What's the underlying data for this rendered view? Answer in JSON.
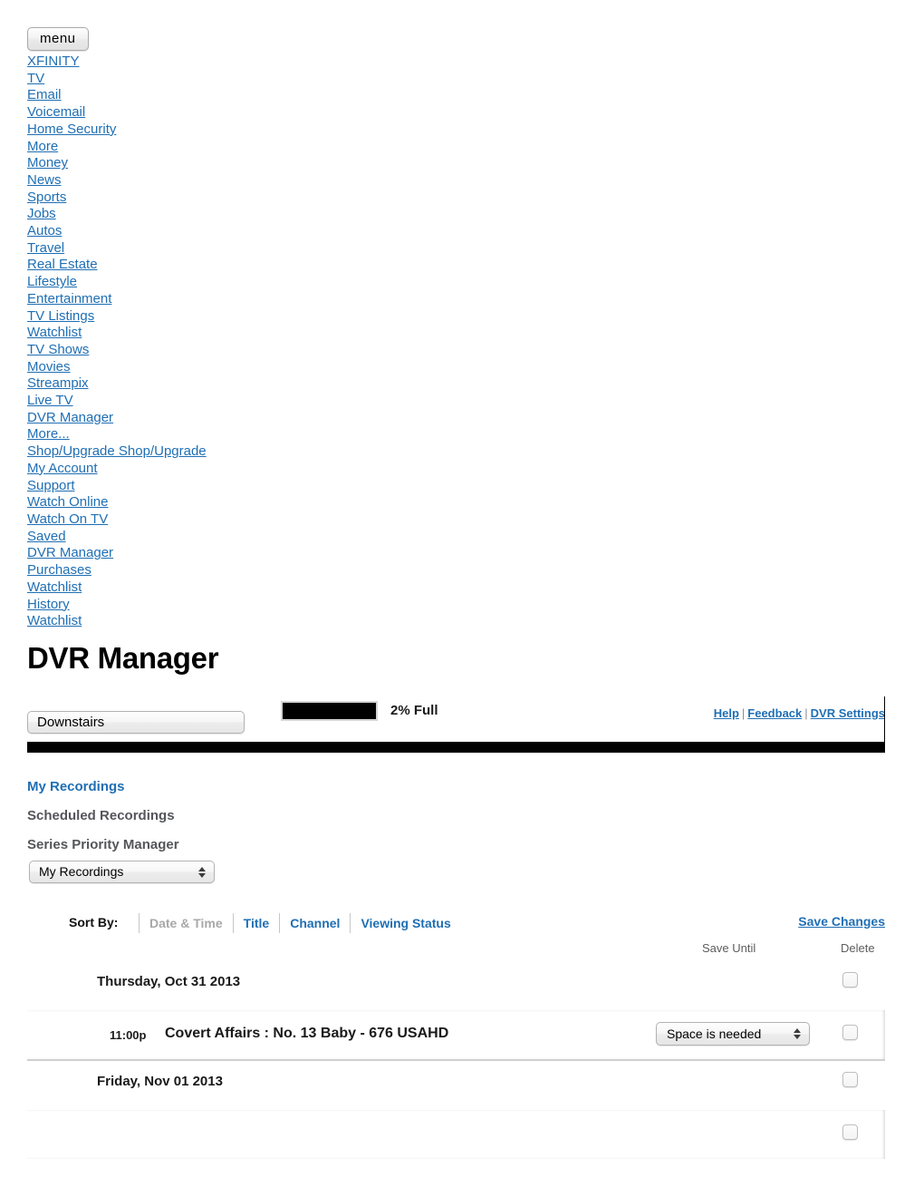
{
  "nav": {
    "menu_button": "menu",
    "links": [
      "XFINITY",
      "TV",
      "Email",
      "Voicemail",
      "Home Security",
      "More",
      "Money",
      "News",
      "Sports",
      "Jobs",
      "Autos",
      "Travel",
      "Real Estate",
      "Lifestyle",
      "Entertainment",
      "TV Listings",
      "Watchlist",
      "TV Shows",
      "Movies",
      "Streampix",
      "Live TV",
      "DVR Manager",
      "More...",
      "Shop/Upgrade Shop/Upgrade",
      "My Account",
      "Support",
      "Watch Online",
      "Watch On TV",
      "Saved",
      "DVR Manager",
      "Purchases",
      "Watchlist",
      "History",
      "Watchlist"
    ]
  },
  "page": {
    "title": "DVR Manager"
  },
  "dvr_bar": {
    "device_selected": "Downstairs",
    "storage_percent": 2,
    "storage_label": "2% Full",
    "links": [
      {
        "label": "Help"
      },
      {
        "label": "Feedback"
      },
      {
        "label": "DVR Settings"
      }
    ],
    "separator": "|"
  },
  "section_tabs": [
    {
      "label": "My Recordings",
      "active": true
    },
    {
      "label": "Scheduled Recordings",
      "active": false
    },
    {
      "label": "Series Priority Manager",
      "active": false
    }
  ],
  "view_select": {
    "selected": "My Recordings"
  },
  "sort_bar": {
    "label": "Sort By:",
    "options": [
      {
        "label": "Date & Time",
        "current": true
      },
      {
        "label": "Title",
        "current": false
      },
      {
        "label": "Channel",
        "current": false
      },
      {
        "label": "Viewing Status",
        "current": false
      }
    ],
    "save_changes": "Save Changes"
  },
  "columns": {
    "save_until": "Save Until",
    "delete": "Delete"
  },
  "groups": [
    {
      "date": "Thursday, Oct 31 2013",
      "rows": [
        {
          "time": "11:00p",
          "title": "Covert Affairs : No. 13 Baby - 676 USAHD",
          "save_until": "Space is needed",
          "has_select": true
        }
      ]
    },
    {
      "date": "Friday, Nov 01 2013",
      "rows": [
        {
          "time": "",
          "title": "",
          "save_until": "",
          "has_select": false
        }
      ]
    }
  ],
  "colors": {
    "link": "#1f6fb4",
    "muted": "#a8a8a8",
    "bar": "#000000"
  }
}
